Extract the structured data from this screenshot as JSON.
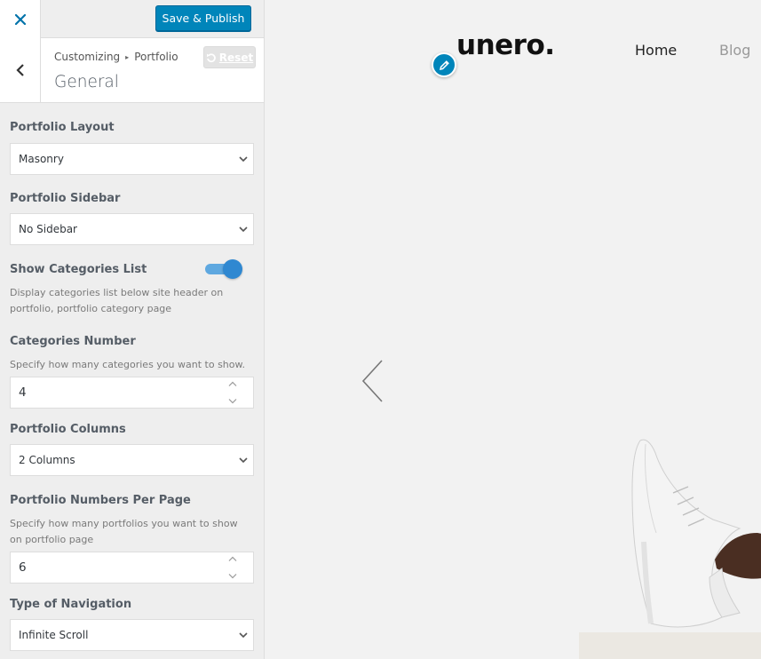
{
  "header": {
    "publish_label": "Save & Publish"
  },
  "section": {
    "breadcrumb_root": "Customizing",
    "breadcrumb_separator": "▸",
    "breadcrumb_current": "Portfolio",
    "title": "General",
    "reset_label": "Reset"
  },
  "controls": {
    "layout": {
      "label": "Portfolio Layout",
      "value": "Masonry"
    },
    "sidebar": {
      "label": "Portfolio Sidebar",
      "value": "No Sidebar"
    },
    "show_categories": {
      "label": "Show Categories List",
      "description": "Display categories list below site header on portfolio, portfolio category page",
      "enabled": true
    },
    "categories_number": {
      "label": "Categories Number",
      "description": "Specify how many categories you want to show.",
      "value": "4"
    },
    "columns": {
      "label": "Portfolio Columns",
      "value": "2 Columns"
    },
    "per_page": {
      "label": "Portfolio Numbers Per Page",
      "description": "Specify how many portfolios you want to show on portfolio page",
      "value": "6"
    },
    "navigation": {
      "label": "Type of Navigation",
      "value": "Infinite Scroll"
    }
  },
  "preview": {
    "logo": "unero.",
    "nav": [
      "Home",
      "Blog"
    ]
  },
  "colors": {
    "accent": "#0085ba",
    "toggle_on": "#2f88d1",
    "sidebar_bg": "#eeeeee",
    "preview_bg": "#f2f2f2"
  },
  "icons": {
    "close": "close-icon",
    "back": "chevron-left-icon",
    "reset": "undo-icon",
    "select": "chevron-down-icon",
    "edit": "pencil-icon",
    "slider_prev": "chevron-left-icon"
  }
}
